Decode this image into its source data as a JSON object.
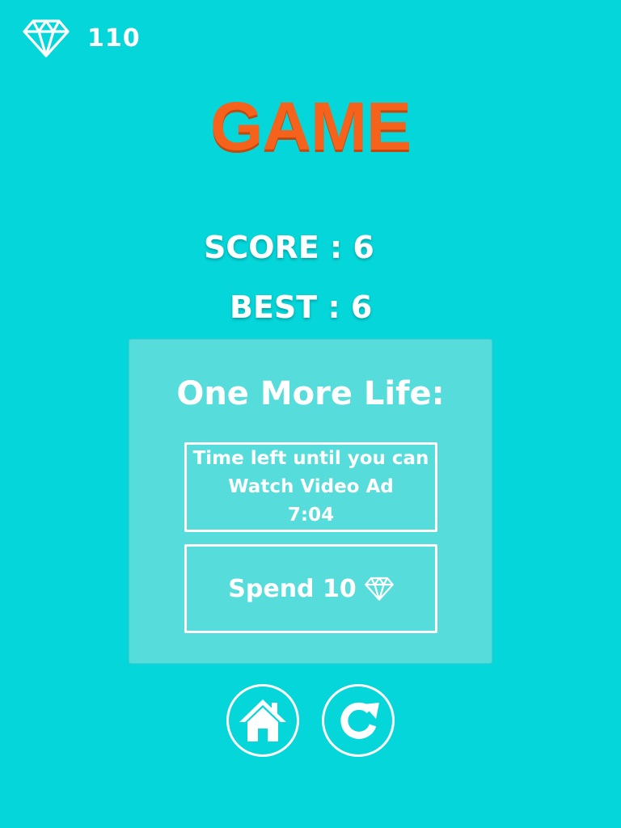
{
  "hud": {
    "gem_icon": "diamond-outline-icon",
    "gem_count": "110"
  },
  "title": "GAME",
  "score": {
    "score_text": "SCORE : 6",
    "best_text": "BEST : 6"
  },
  "one_more_life": {
    "title": "One More Life:",
    "video_ad": {
      "line1": "Time left until you can",
      "line2": "Watch Video Ad",
      "timer": "7:04"
    },
    "spend": {
      "label": "Spend 10",
      "icon": "diamond-outline-icon"
    }
  },
  "buttons": {
    "home_icon": "home-icon",
    "restart_icon": "restart-icon"
  },
  "colors": {
    "background": "#04d6d9",
    "panel": "#56dcdb",
    "title": "#f4621b",
    "text": "#ffffff"
  }
}
